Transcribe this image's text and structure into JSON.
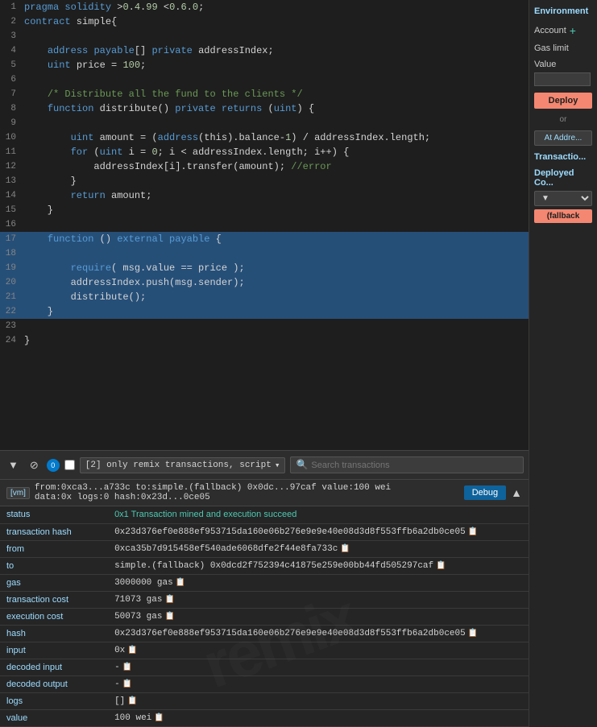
{
  "editor": {
    "lines": [
      {
        "num": 1,
        "content": "pragma solidity >0.4.99 <0.6.0;",
        "highlight": false
      },
      {
        "num": 2,
        "content": "contract simple{",
        "highlight": false
      },
      {
        "num": 3,
        "content": "",
        "highlight": false
      },
      {
        "num": 4,
        "content": "    address payable[] private addressIndex;",
        "highlight": false
      },
      {
        "num": 5,
        "content": "    uint price = 100;",
        "highlight": false
      },
      {
        "num": 6,
        "content": "",
        "highlight": false
      },
      {
        "num": 7,
        "content": "    /* Distribute all the fund to the clients */",
        "highlight": false
      },
      {
        "num": 8,
        "content": "    function distribute() private returns (uint) {",
        "highlight": false
      },
      {
        "num": 9,
        "content": "",
        "highlight": false
      },
      {
        "num": 10,
        "content": "        uint amount = (address(this).balance-1) / addressIndex.length;",
        "highlight": false
      },
      {
        "num": 11,
        "content": "        for (uint i = 0; i < addressIndex.length; i++) {",
        "highlight": false
      },
      {
        "num": 12,
        "content": "            addressIndex[i].transfer(amount); //error",
        "highlight": false
      },
      {
        "num": 13,
        "content": "        }",
        "highlight": false
      },
      {
        "num": 14,
        "content": "        return amount;",
        "highlight": false
      },
      {
        "num": 15,
        "content": "    }",
        "highlight": false
      },
      {
        "num": 16,
        "content": "",
        "highlight": false
      },
      {
        "num": 17,
        "content": "    function () external payable {",
        "highlight": true
      },
      {
        "num": 18,
        "content": "",
        "highlight": true
      },
      {
        "num": 19,
        "content": "        require( msg.value == price );",
        "highlight": true
      },
      {
        "num": 20,
        "content": "        addressIndex.push(msg.sender);",
        "highlight": true
      },
      {
        "num": 21,
        "content": "        distribute();",
        "highlight": true
      },
      {
        "num": 22,
        "content": "    }",
        "highlight": true
      },
      {
        "num": 23,
        "content": "",
        "highlight": false
      },
      {
        "num": 24,
        "content": "}",
        "highlight": false
      }
    ]
  },
  "toolbar": {
    "badge_count": "0",
    "dropdown_label": "[2] only remix transactions, script",
    "search_placeholder": "Search transactions"
  },
  "transaction": {
    "vm_label": "[vm]",
    "summary": "from:0xca3...a733c to:simple.(fallback) 0x0dc...97caf value:100 wei",
    "data_info": "data:0x logs:0 hash:0x23d...0ce05",
    "debug_label": "Debug",
    "collapse_label": "▲",
    "fields": [
      {
        "key": "status",
        "value": "0x1 Transaction mined and execution succeed"
      },
      {
        "key": "transaction hash",
        "value": "0x23d376ef0e888ef953715da160e06b276e9e9e40e08d3d8f553ffb6a2db0ce05"
      },
      {
        "key": "from",
        "value": "0xca35b7d915458ef540ade6068dfe2f44e8fa733c"
      },
      {
        "key": "to",
        "value": "simple.(fallback) 0x0dcd2f752394c41875e259e00bb44fd505297caf"
      },
      {
        "key": "gas",
        "value": "3000000 gas"
      },
      {
        "key": "transaction cost",
        "value": "71073 gas"
      },
      {
        "key": "execution cost",
        "value": "50073 gas"
      },
      {
        "key": "hash",
        "value": "0x23d376ef0e888ef953715da160e06b276e9e9e40e08d3d8f553ffb6a2db0ce05"
      },
      {
        "key": "input",
        "value": "0x"
      },
      {
        "key": "decoded input",
        "value": "-"
      },
      {
        "key": "decoded output",
        "value": "-"
      },
      {
        "key": "logs",
        "value": "[]"
      },
      {
        "key": "value",
        "value": "100 wei"
      }
    ]
  },
  "sidebar": {
    "environment_label": "Environment",
    "account_label": "Account",
    "gas_limit_label": "Gas limit",
    "value_label": "Value",
    "deploy_label": "Deploy",
    "or_label": "or",
    "at_address_label": "At Addre...",
    "transaction_label": "Transactio...",
    "deployed_label": "Deployed Co...",
    "dropdown_label": "▼",
    "fallback_label": "(fallback"
  },
  "watermark": "remix"
}
